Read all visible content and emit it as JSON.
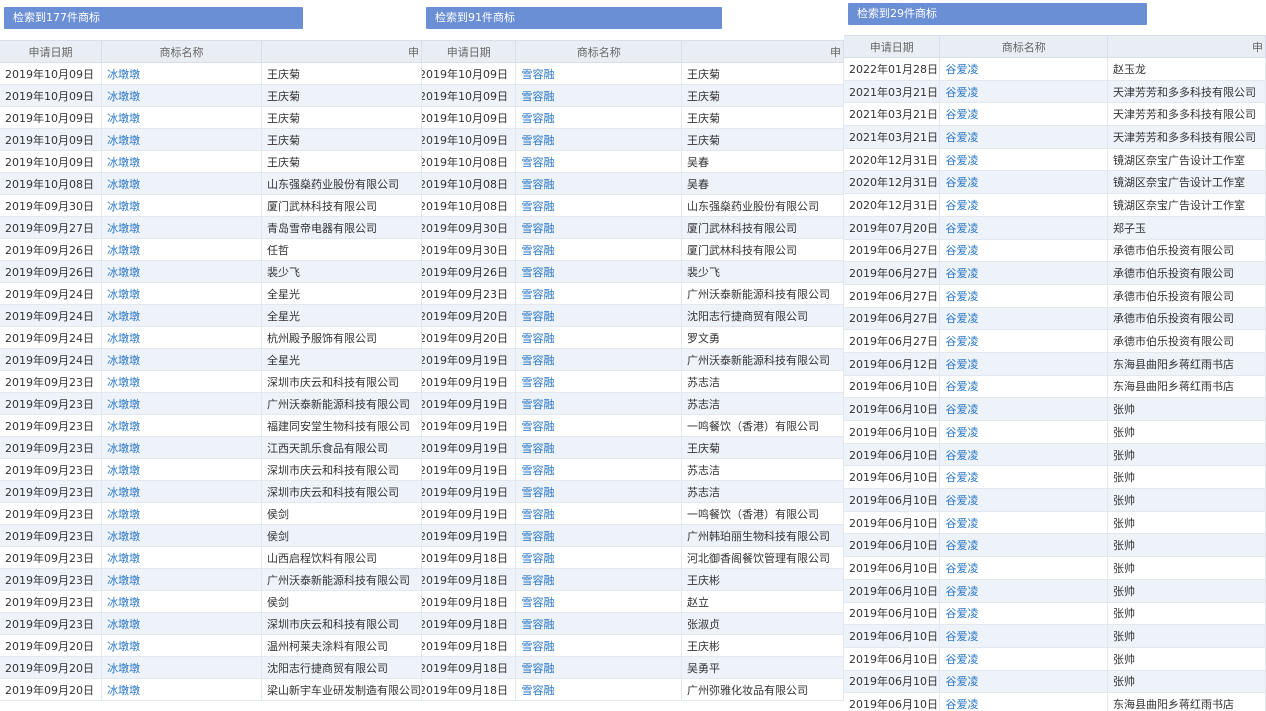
{
  "headers": {
    "date": "申请日期",
    "name": "商标名称",
    "applicant_cut": "申"
  },
  "panels": [
    {
      "badge": "检索到177件商标",
      "name": "冰墩墩",
      "rows": [
        [
          "2019年10月09日",
          "王庆菊"
        ],
        [
          "2019年10月09日",
          "王庆菊"
        ],
        [
          "2019年10月09日",
          "王庆菊"
        ],
        [
          "2019年10月09日",
          "王庆菊"
        ],
        [
          "2019年10月09日",
          "王庆菊"
        ],
        [
          "2019年10月08日",
          "山东强燊药业股份有限公司"
        ],
        [
          "2019年09月30日",
          "厦门武林科技有限公司"
        ],
        [
          "2019年09月27日",
          "青岛雪帝电器有限公司"
        ],
        [
          "2019年09月26日",
          "任哲"
        ],
        [
          "2019年09月26日",
          "裴少飞"
        ],
        [
          "2019年09月24日",
          "全星光"
        ],
        [
          "2019年09月24日",
          "全星光"
        ],
        [
          "2019年09月24日",
          "杭州殿予服饰有限公司"
        ],
        [
          "2019年09月24日",
          "全星光"
        ],
        [
          "2019年09月23日",
          "深圳市庆云和科技有限公司"
        ],
        [
          "2019年09月23日",
          "广州沃泰新能源科技有限公司"
        ],
        [
          "2019年09月23日",
          "福建同安堂生物科技有限公司"
        ],
        [
          "2019年09月23日",
          "江西天凯乐食品有限公司"
        ],
        [
          "2019年09月23日",
          "深圳市庆云和科技有限公司"
        ],
        [
          "2019年09月23日",
          "深圳市庆云和科技有限公司"
        ],
        [
          "2019年09月23日",
          "侯剑"
        ],
        [
          "2019年09月23日",
          "侯剑"
        ],
        [
          "2019年09月23日",
          "山西启程饮料有限公司"
        ],
        [
          "2019年09月23日",
          "广州沃泰新能源科技有限公司"
        ],
        [
          "2019年09月23日",
          "侯剑"
        ],
        [
          "2019年09月23日",
          "深圳市庆云和科技有限公司"
        ],
        [
          "2019年09月20日",
          "温州柯莱夫涂料有限公司"
        ],
        [
          "2019年09月20日",
          "沈阳志行捷商贸有限公司"
        ],
        [
          "2019年09月20日",
          "梁山新宇车业研发制造有限公司"
        ]
      ]
    },
    {
      "badge": "检索到91件商标",
      "name": "雪容融",
      "rows": [
        [
          "2019年10月09日",
          "王庆菊"
        ],
        [
          "2019年10月09日",
          "王庆菊"
        ],
        [
          "2019年10月09日",
          "王庆菊"
        ],
        [
          "2019年10月09日",
          "王庆菊"
        ],
        [
          "2019年10月08日",
          "吴春"
        ],
        [
          "2019年10月08日",
          "吴春"
        ],
        [
          "2019年10月08日",
          "山东强燊药业股份有限公司"
        ],
        [
          "2019年09月30日",
          "厦门武林科技有限公司"
        ],
        [
          "2019年09月30日",
          "厦门武林科技有限公司"
        ],
        [
          "2019年09月26日",
          "裴少飞"
        ],
        [
          "2019年09月23日",
          "广州沃泰新能源科技有限公司"
        ],
        [
          "2019年09月20日",
          "沈阳志行捷商贸有限公司"
        ],
        [
          "2019年09月20日",
          "罗文勇"
        ],
        [
          "2019年09月19日",
          "广州沃泰新能源科技有限公司"
        ],
        [
          "2019年09月19日",
          "苏志洁"
        ],
        [
          "2019年09月19日",
          "苏志洁"
        ],
        [
          "2019年09月19日",
          "一鸣餐饮（香港）有限公司"
        ],
        [
          "2019年09月19日",
          "王庆菊"
        ],
        [
          "2019年09月19日",
          "苏志洁"
        ],
        [
          "2019年09月19日",
          "苏志洁"
        ],
        [
          "2019年09月19日",
          "一鸣餐饮（香港）有限公司"
        ],
        [
          "2019年09月19日",
          "广州韩珀丽生物科技有限公司"
        ],
        [
          "2019年09月18日",
          "河北御香阁餐饮管理有限公司"
        ],
        [
          "2019年09月18日",
          "王庆彬"
        ],
        [
          "2019年09月18日",
          "赵立"
        ],
        [
          "2019年09月18日",
          "张淑贞"
        ],
        [
          "2019年09月18日",
          "王庆彬"
        ],
        [
          "2019年09月18日",
          "吴勇平"
        ],
        [
          "2019年09月18日",
          "广州弥雅化妆品有限公司"
        ]
      ]
    },
    {
      "badge": "检索到29件商标",
      "name": "谷爱凌",
      "rows": [
        [
          "2022年01月28日",
          "赵玉龙"
        ],
        [
          "2021年03月21日",
          "天津芳芳和多多科技有限公司"
        ],
        [
          "2021年03月21日",
          "天津芳芳和多多科技有限公司"
        ],
        [
          "2021年03月21日",
          "天津芳芳和多多科技有限公司"
        ],
        [
          "2020年12月31日",
          "镜湖区奈宝广告设计工作室"
        ],
        [
          "2020年12月31日",
          "镜湖区奈宝广告设计工作室"
        ],
        [
          "2020年12月31日",
          "镜湖区奈宝广告设计工作室"
        ],
        [
          "2019年07月20日",
          "郑子玉"
        ],
        [
          "2019年06月27日",
          "承德市伯乐投资有限公司"
        ],
        [
          "2019年06月27日",
          "承德市伯乐投资有限公司"
        ],
        [
          "2019年06月27日",
          "承德市伯乐投资有限公司"
        ],
        [
          "2019年06月27日",
          "承德市伯乐投资有限公司"
        ],
        [
          "2019年06月27日",
          "承德市伯乐投资有限公司"
        ],
        [
          "2019年06月12日",
          "东海县曲阳乡蒋红雨书店"
        ],
        [
          "2019年06月10日",
          "东海县曲阳乡蒋红雨书店"
        ],
        [
          "2019年06月10日",
          "张帅"
        ],
        [
          "2019年06月10日",
          "张帅"
        ],
        [
          "2019年06月10日",
          "张帅"
        ],
        [
          "2019年06月10日",
          "张帅"
        ],
        [
          "2019年06月10日",
          "张帅"
        ],
        [
          "2019年06月10日",
          "张帅"
        ],
        [
          "2019年06月10日",
          "张帅"
        ],
        [
          "2019年06月10日",
          "张帅"
        ],
        [
          "2019年06月10日",
          "张帅"
        ],
        [
          "2019年06月10日",
          "张帅"
        ],
        [
          "2019年06月10日",
          "张帅"
        ],
        [
          "2019年06月10日",
          "张帅"
        ],
        [
          "2019年06月10日",
          "张帅"
        ],
        [
          "2019年06月10日",
          "东海县曲阳乡蒋红雨书店"
        ]
      ]
    }
  ]
}
